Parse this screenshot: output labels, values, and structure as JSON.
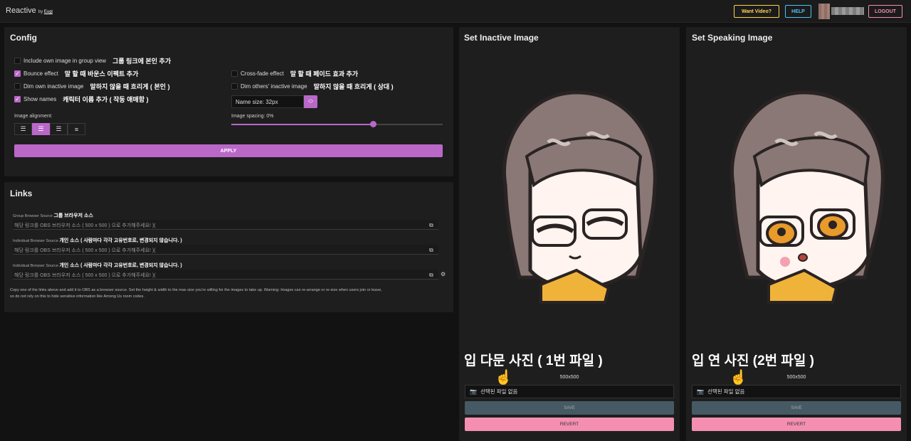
{
  "header": {
    "brand": "Reactive",
    "brand_by": "by",
    "brand_author": "Eugi",
    "want_video": "Want Video?",
    "help": "HELP",
    "logout": "LOGOUT"
  },
  "config": {
    "title": "Config",
    "options": [
      {
        "label": "Include own image in group view",
        "ko": "그룹 링크에 본인 추가",
        "checked": false
      },
      {
        "label": "Bounce effect",
        "ko": "말 할 때 바운스 이펙트 추가",
        "checked": true
      },
      {
        "label": "Dim own inactive image",
        "ko": "말하지 않을 때 흐리게 ( 본인 )",
        "checked": false
      },
      {
        "label": "Show names",
        "ko": "캐릭터 이름 추가 ( 작동 애매함 )",
        "checked": true
      },
      {
        "label": "Cross-fade effect",
        "ko": "말 할 때 페이드 효과 추가",
        "checked": false
      },
      {
        "label": "Dim others' inactive image",
        "ko": "말하지 않을 때 흐리게 ( 상대 )",
        "checked": false
      }
    ],
    "name_size": "Name size: 32px",
    "image_alignment_label": "Image alignment:",
    "image_spacing_label": "Image spacing: 0%",
    "image_spacing_value": 0.67,
    "selected_alignment": 1,
    "apply": "APPLY"
  },
  "links": {
    "title": "Links",
    "sources": [
      {
        "label": "Group Browser Source",
        "ko": "그룹 브라우저 소스",
        "value": "해당 링크를 OBS 브라우저 소스 ( 500 x 500 ) 으로 추가해주세요! )("
      },
      {
        "label": "Individual Browser Source",
        "ko": "개인 소스 ( 사람마다 각각 고유번호로, 변경되지 않습니다. )",
        "value": "해당 링크를 OBS 브라우저 소스 ( 500 x 500 ) 으로 추가해주세요! )("
      },
      {
        "label": "Individual Browser Source",
        "ko": "개인 소스 ( 사람마다 각각 고유번호로, 변경되지 않습니다. )",
        "value": "해당 링크를 OBS 브라우저 소스 ( 500 x 500 ) 으로 추가해주세요! )("
      }
    ],
    "note_line1": "Copy one of the links above and add it to OBS as a browser source. Set the height & width to the max size you're willing for the images to take up. Warning: Images can re-arrange or re-size when users join or leave,",
    "note_line2": "so do not rely on this to hide sensitive information like Among Us room codes."
  },
  "inactive": {
    "title": "Set Inactive Image",
    "caption": "입 다문 사진 ( 1번 파일 )",
    "dims": "500x500",
    "file": "선택된 파일 없음",
    "save": "SAVE",
    "revert": "REVERT"
  },
  "speaking": {
    "title": "Set Speaking Image",
    "caption": "입 연 사진 (2번 파일 )",
    "dims": "500x500",
    "file": "선택된 파일 없음",
    "save": "SAVE",
    "revert": "REVERT"
  },
  "colors": {
    "accent": "#ba68c8",
    "revert": "#f48fb1",
    "save": "#455a64",
    "want_video": "#ffd54f",
    "help": "#4fc3f7",
    "logout": "#f48fb1"
  },
  "icons": {
    "copy": "copy-icon",
    "gear": "gear-icon",
    "camera": "camera-icon",
    "hand": "pointing-hand-icon"
  }
}
